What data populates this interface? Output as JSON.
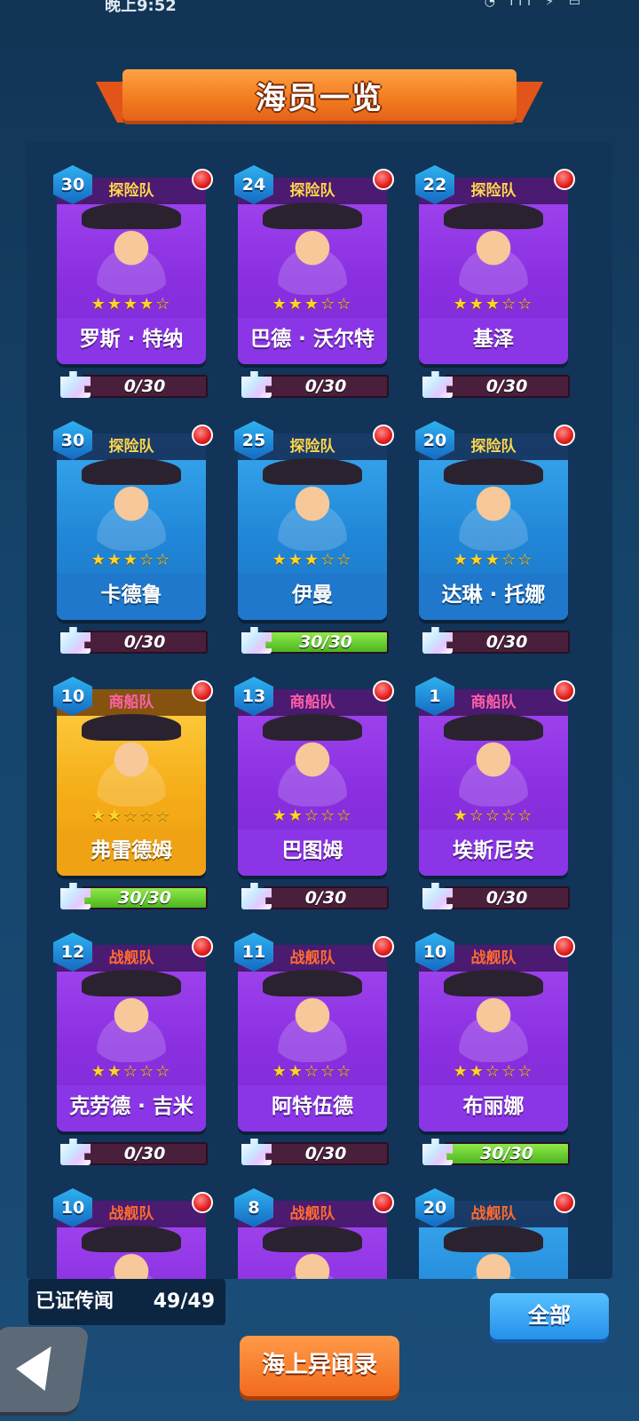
{
  "status_bar": {
    "time": "晚上9:52",
    "icons": "◔ ıll ⚡ ▭"
  },
  "title": "海员一览",
  "crew": [
    {
      "level": "30",
      "team": "探险队",
      "team_type": "explore",
      "name": "罗斯 · 特纳",
      "stars": 4,
      "stars_text": "★★★★☆",
      "progress": "0/30",
      "fraction": 0,
      "color": "purple"
    },
    {
      "level": "24",
      "team": "探险队",
      "team_type": "explore",
      "name": "巴德 · 沃尔特",
      "stars": 3,
      "stars_text": "★★★☆☆",
      "progress": "0/30",
      "fraction": 0,
      "color": "purple"
    },
    {
      "level": "22",
      "team": "探险队",
      "team_type": "explore",
      "name": "基泽",
      "stars": 3,
      "stars_text": "★★★☆☆",
      "progress": "0/30",
      "fraction": 0,
      "color": "purple"
    },
    {
      "level": "30",
      "team": "探险队",
      "team_type": "explore",
      "name": "卡德鲁",
      "stars": 3,
      "stars_text": "★★★☆☆",
      "progress": "0/30",
      "fraction": 0,
      "color": "blue"
    },
    {
      "level": "25",
      "team": "探险队",
      "team_type": "explore",
      "name": "伊曼",
      "stars": 3,
      "stars_text": "★★★☆☆",
      "progress": "30/30",
      "fraction": 1,
      "color": "blue"
    },
    {
      "level": "20",
      "team": "探险队",
      "team_type": "explore",
      "name": "达琳 · 托娜",
      "stars": 3,
      "stars_text": "★★★☆☆",
      "progress": "0/30",
      "fraction": 0,
      "color": "blue"
    },
    {
      "level": "10",
      "team": "商船队",
      "team_type": "merchant",
      "name": "弗雷德姆",
      "stars": 2,
      "stars_text": "★★☆☆☆",
      "progress": "30/30",
      "fraction": 1,
      "color": "gold"
    },
    {
      "level": "13",
      "team": "商船队",
      "team_type": "merchant",
      "name": "巴图姆",
      "stars": 2,
      "stars_text": "★★☆☆☆",
      "progress": "0/30",
      "fraction": 0,
      "color": "purple"
    },
    {
      "level": "1",
      "team": "商船队",
      "team_type": "merchant",
      "name": "埃斯尼安",
      "stars": 1,
      "stars_text": "★☆☆☆☆",
      "progress": "0/30",
      "fraction": 0,
      "color": "purple"
    },
    {
      "level": "12",
      "team": "战舰队",
      "team_type": "warship",
      "name": "克劳德 · 吉米",
      "stars": 2,
      "stars_text": "★★☆☆☆",
      "progress": "0/30",
      "fraction": 0,
      "color": "purple"
    },
    {
      "level": "11",
      "team": "战舰队",
      "team_type": "warship",
      "name": "阿特伍德",
      "stars": 2,
      "stars_text": "★★☆☆☆",
      "progress": "0/30",
      "fraction": 0,
      "color": "purple"
    },
    {
      "level": "10",
      "team": "战舰队",
      "team_type": "warship",
      "name": "布丽娜",
      "stars": 2,
      "stars_text": "★★☆☆☆",
      "progress": "30/30",
      "fraction": 1,
      "color": "purple"
    },
    {
      "level": "10",
      "team": "战舰队",
      "team_type": "warship",
      "color": "purple"
    },
    {
      "level": "8",
      "team": "战舰队",
      "team_type": "warship",
      "color": "purple"
    },
    {
      "level": "20",
      "team": "战舰队",
      "team_type": "warship",
      "color": "blue"
    }
  ],
  "proven": {
    "label": "已证传闻",
    "value": "49/49"
  },
  "buttons": {
    "all": "全部",
    "chronicle": "海上异闻录"
  },
  "colors": {
    "explore": "#ffd54a",
    "merchant": "#ff5fa8",
    "warship": "#ff6a2e",
    "progress_full": "#5fcf2a"
  }
}
